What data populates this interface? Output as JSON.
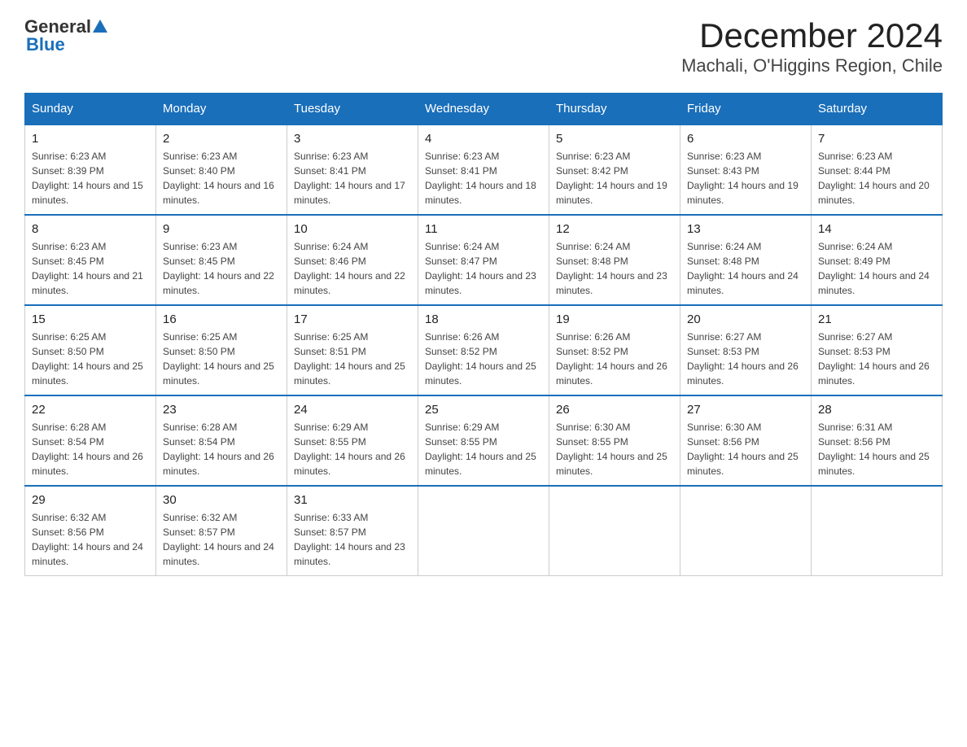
{
  "header": {
    "title": "December 2024",
    "subtitle": "Machali, O'Higgins Region, Chile",
    "logo_general": "General",
    "logo_blue": "Blue"
  },
  "calendar": {
    "days_of_week": [
      "Sunday",
      "Monday",
      "Tuesday",
      "Wednesday",
      "Thursday",
      "Friday",
      "Saturday"
    ],
    "weeks": [
      [
        {
          "day": "1",
          "sunrise": "6:23 AM",
          "sunset": "8:39 PM",
          "daylight": "14 hours and 15 minutes."
        },
        {
          "day": "2",
          "sunrise": "6:23 AM",
          "sunset": "8:40 PM",
          "daylight": "14 hours and 16 minutes."
        },
        {
          "day": "3",
          "sunrise": "6:23 AM",
          "sunset": "8:41 PM",
          "daylight": "14 hours and 17 minutes."
        },
        {
          "day": "4",
          "sunrise": "6:23 AM",
          "sunset": "8:41 PM",
          "daylight": "14 hours and 18 minutes."
        },
        {
          "day": "5",
          "sunrise": "6:23 AM",
          "sunset": "8:42 PM",
          "daylight": "14 hours and 19 minutes."
        },
        {
          "day": "6",
          "sunrise": "6:23 AM",
          "sunset": "8:43 PM",
          "daylight": "14 hours and 19 minutes."
        },
        {
          "day": "7",
          "sunrise": "6:23 AM",
          "sunset": "8:44 PM",
          "daylight": "14 hours and 20 minutes."
        }
      ],
      [
        {
          "day": "8",
          "sunrise": "6:23 AM",
          "sunset": "8:45 PM",
          "daylight": "14 hours and 21 minutes."
        },
        {
          "day": "9",
          "sunrise": "6:23 AM",
          "sunset": "8:45 PM",
          "daylight": "14 hours and 22 minutes."
        },
        {
          "day": "10",
          "sunrise": "6:24 AM",
          "sunset": "8:46 PM",
          "daylight": "14 hours and 22 minutes."
        },
        {
          "day": "11",
          "sunrise": "6:24 AM",
          "sunset": "8:47 PM",
          "daylight": "14 hours and 23 minutes."
        },
        {
          "day": "12",
          "sunrise": "6:24 AM",
          "sunset": "8:48 PM",
          "daylight": "14 hours and 23 minutes."
        },
        {
          "day": "13",
          "sunrise": "6:24 AM",
          "sunset": "8:48 PM",
          "daylight": "14 hours and 24 minutes."
        },
        {
          "day": "14",
          "sunrise": "6:24 AM",
          "sunset": "8:49 PM",
          "daylight": "14 hours and 24 minutes."
        }
      ],
      [
        {
          "day": "15",
          "sunrise": "6:25 AM",
          "sunset": "8:50 PM",
          "daylight": "14 hours and 25 minutes."
        },
        {
          "day": "16",
          "sunrise": "6:25 AM",
          "sunset": "8:50 PM",
          "daylight": "14 hours and 25 minutes."
        },
        {
          "day": "17",
          "sunrise": "6:25 AM",
          "sunset": "8:51 PM",
          "daylight": "14 hours and 25 minutes."
        },
        {
          "day": "18",
          "sunrise": "6:26 AM",
          "sunset": "8:52 PM",
          "daylight": "14 hours and 25 minutes."
        },
        {
          "day": "19",
          "sunrise": "6:26 AM",
          "sunset": "8:52 PM",
          "daylight": "14 hours and 26 minutes."
        },
        {
          "day": "20",
          "sunrise": "6:27 AM",
          "sunset": "8:53 PM",
          "daylight": "14 hours and 26 minutes."
        },
        {
          "day": "21",
          "sunrise": "6:27 AM",
          "sunset": "8:53 PM",
          "daylight": "14 hours and 26 minutes."
        }
      ],
      [
        {
          "day": "22",
          "sunrise": "6:28 AM",
          "sunset": "8:54 PM",
          "daylight": "14 hours and 26 minutes."
        },
        {
          "day": "23",
          "sunrise": "6:28 AM",
          "sunset": "8:54 PM",
          "daylight": "14 hours and 26 minutes."
        },
        {
          "day": "24",
          "sunrise": "6:29 AM",
          "sunset": "8:55 PM",
          "daylight": "14 hours and 26 minutes."
        },
        {
          "day": "25",
          "sunrise": "6:29 AM",
          "sunset": "8:55 PM",
          "daylight": "14 hours and 25 minutes."
        },
        {
          "day": "26",
          "sunrise": "6:30 AM",
          "sunset": "8:55 PM",
          "daylight": "14 hours and 25 minutes."
        },
        {
          "day": "27",
          "sunrise": "6:30 AM",
          "sunset": "8:56 PM",
          "daylight": "14 hours and 25 minutes."
        },
        {
          "day": "28",
          "sunrise": "6:31 AM",
          "sunset": "8:56 PM",
          "daylight": "14 hours and 25 minutes."
        }
      ],
      [
        {
          "day": "29",
          "sunrise": "6:32 AM",
          "sunset": "8:56 PM",
          "daylight": "14 hours and 24 minutes."
        },
        {
          "day": "30",
          "sunrise": "6:32 AM",
          "sunset": "8:57 PM",
          "daylight": "14 hours and 24 minutes."
        },
        {
          "day": "31",
          "sunrise": "6:33 AM",
          "sunset": "8:57 PM",
          "daylight": "14 hours and 23 minutes."
        },
        null,
        null,
        null,
        null
      ]
    ]
  }
}
